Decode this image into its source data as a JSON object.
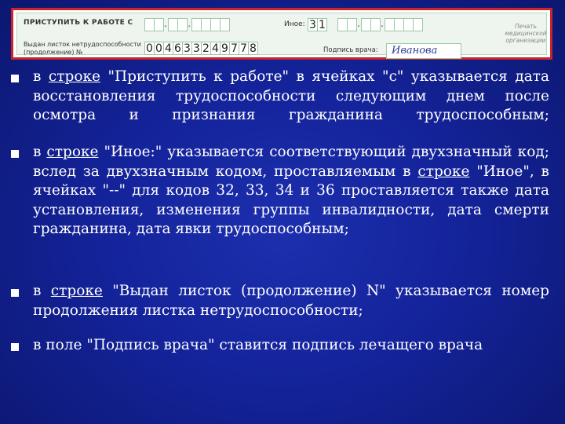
{
  "form": {
    "start_label": "ПРИСТУПИТЬ К РАБОТЕ С",
    "other_label": "Иное:",
    "other_code": [
      "3",
      "1"
    ],
    "issued_label_line1": "Выдан листок нетрудоспособности",
    "issued_label_line2": "(продолжение) №",
    "issued_number": [
      "0",
      "0",
      "4",
      "6",
      "3",
      "3",
      "2",
      "4",
      "9",
      "7",
      "7",
      "8"
    ],
    "doctor_signature_label": "Подпись врача:",
    "doctor_signature": "Иванова",
    "stamp_label": "Печать медицинской организации",
    "dot": "."
  },
  "items": [
    {
      "pre": "в ",
      "link": "строке",
      "post": " \"Приступить к работе\" в ячейках \"с\" указывается дата восстановления трудоспособности следующим днем после осмотра и признания гражданина трудоспособным;"
    },
    {
      "pre": "в ",
      "link": "строке",
      "mid": " \"Иное:\" указывается соответствующий двухзначный код; вслед за двухзначным кодом, проставляемым в ",
      "link2": "строке",
      "post": " \"Иное\", в ячейках \"--\" для кодов 32, 33, 34 и 36 проставляется также дата установления, изменения группы инвалидности, дата смерти гражданина, дата явки трудоспособным;"
    },
    {
      "pre": "в ",
      "link": "строке",
      "post": " \"Выдан листок (продолжение) N\" указывается номер продолжения листка нетрудоспособности;"
    },
    {
      "text": "в поле \"Подпись врача\" ставится подпись лечащего врача"
    }
  ],
  "colors": {
    "background": "#14239a",
    "text": "#ffffff",
    "form_border": "#c8252b"
  }
}
